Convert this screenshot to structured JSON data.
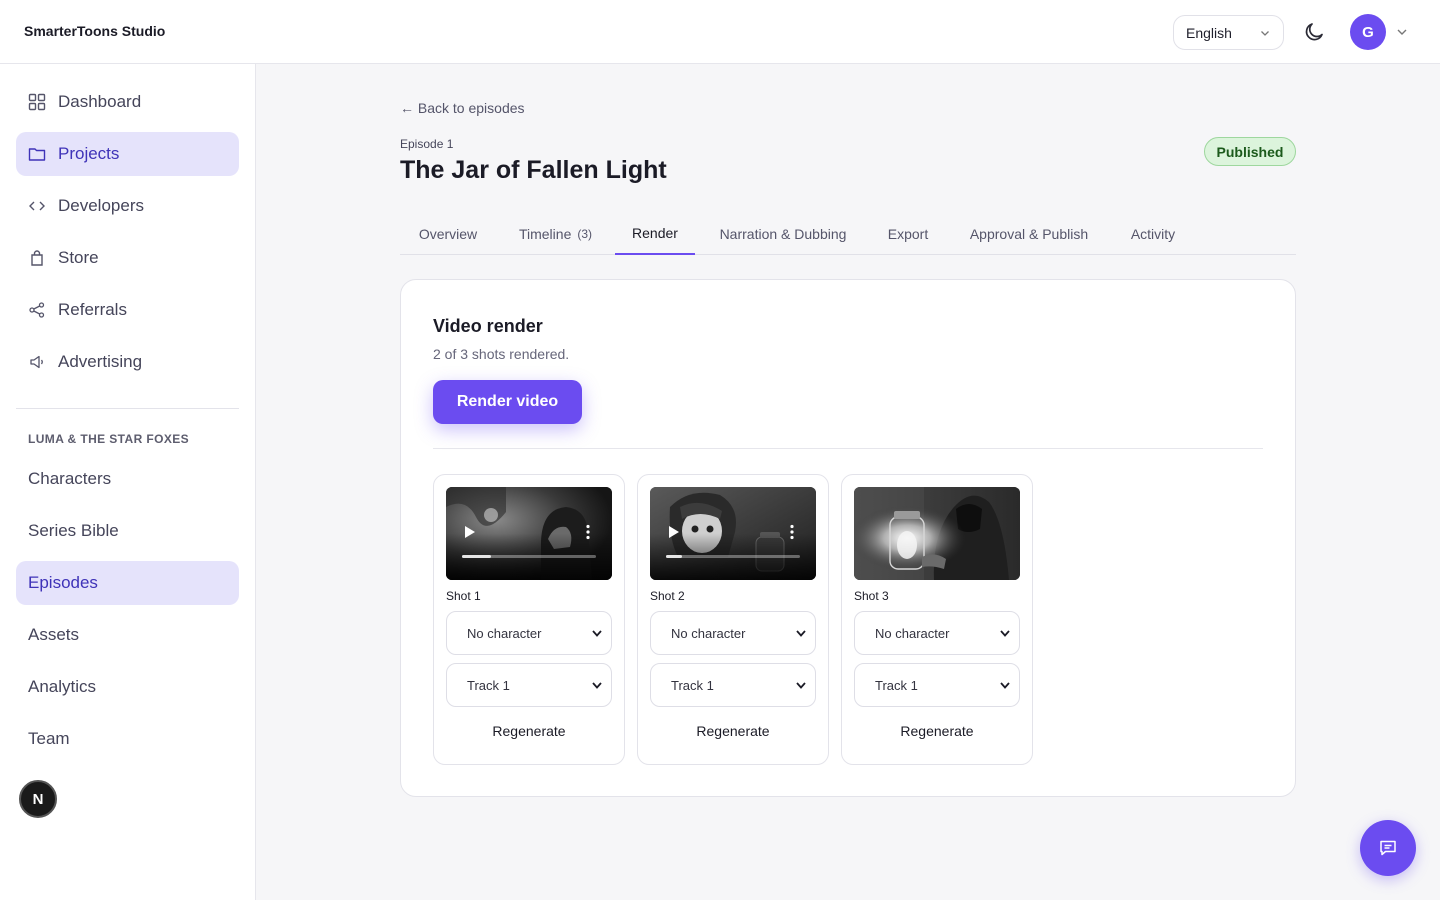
{
  "app": {
    "brand": "SmarterToons Studio"
  },
  "header": {
    "language": "English",
    "avatar_initial": "G",
    "icons": [
      "chevron-down-icon",
      "moon-icon"
    ]
  },
  "sidebar": {
    "items": [
      {
        "label": "Dashboard",
        "icon": "grid-icon"
      },
      {
        "label": "Projects",
        "icon": "folder-icon",
        "active": true
      },
      {
        "label": "Developers",
        "icon": "code-icon"
      },
      {
        "label": "Store",
        "icon": "shopping-bag-icon"
      },
      {
        "label": "Referrals",
        "icon": "share-icon"
      },
      {
        "label": "Advertising",
        "icon": "megaphone-icon"
      }
    ],
    "section_title": "LUMA & THE STAR FOXES",
    "sub_items": [
      {
        "label": "Characters"
      },
      {
        "label": "Series Bible"
      },
      {
        "label": "Episodes",
        "active": true
      },
      {
        "label": "Assets"
      },
      {
        "label": "Analytics"
      },
      {
        "label": "Team"
      }
    ],
    "badge": "N"
  },
  "episode": {
    "back_label": "← Back to episodes",
    "label": "Episode 1",
    "title": "The Jar of Fallen Light",
    "status": "Published",
    "status_color": "#dcf4dc"
  },
  "tabs": [
    {
      "label": "Overview"
    },
    {
      "label": "Timeline",
      "count": "(3)"
    },
    {
      "label": "Render",
      "active": true
    },
    {
      "label": "Narration & Dubbing"
    },
    {
      "label": "Export"
    },
    {
      "label": "Approval & Publish"
    },
    {
      "label": "Activity"
    }
  ],
  "render": {
    "title": "Video render",
    "subtitle": "2 of 3 shots rendered.",
    "button_label": "Render video",
    "shots": [
      {
        "label": "Shot 1",
        "character": "No character",
        "track": "Track 1",
        "regenerate": "Regenerate",
        "is_video": true,
        "progress": 0.22
      },
      {
        "label": "Shot 2",
        "character": "No character",
        "track": "Track 1",
        "regenerate": "Regenerate",
        "is_video": true,
        "progress": 0.12
      },
      {
        "label": "Shot 3",
        "character": "No character",
        "track": "Track 1",
        "regenerate": "Regenerate",
        "is_video": false
      }
    ]
  },
  "colors": {
    "accent": "#6b4cf0",
    "active_bg": "#e5e3fb",
    "published": "#1c5a1c"
  }
}
